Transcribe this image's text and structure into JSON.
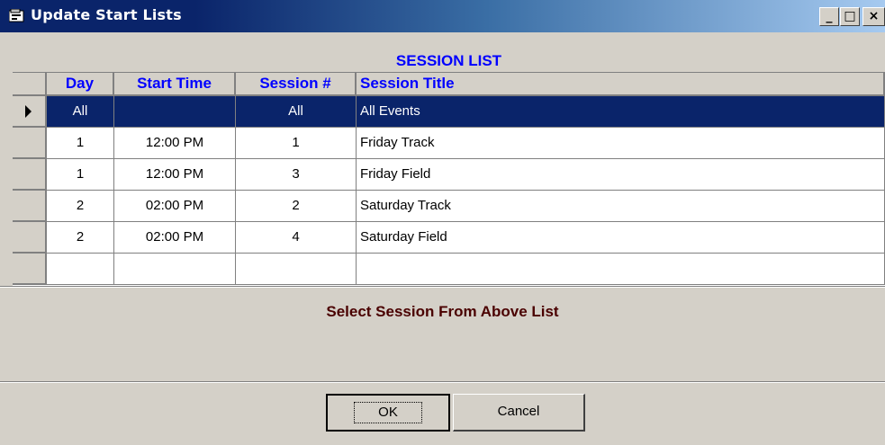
{
  "window": {
    "title": "Update Start Lists",
    "controls": {
      "minimize": "_",
      "maximize": "□",
      "close": "×"
    }
  },
  "grid": {
    "caption": "SESSION LIST",
    "columns": [
      "Day",
      "Start Time",
      "Session #",
      "Session Title"
    ],
    "rows": [
      {
        "day": "All",
        "start_time": "",
        "session": "All",
        "title": "All Events",
        "selected": true
      },
      {
        "day": "1",
        "start_time": "12:00 PM",
        "session": "1",
        "title": "Friday Track",
        "selected": false
      },
      {
        "day": "1",
        "start_time": "12:00 PM",
        "session": "3",
        "title": "Friday Field",
        "selected": false
      },
      {
        "day": "2",
        "start_time": "02:00 PM",
        "session": "2",
        "title": "Saturday Track",
        "selected": false
      },
      {
        "day": "2",
        "start_time": "02:00 PM",
        "session": "4",
        "title": "Saturday Field",
        "selected": false
      },
      {
        "day": "",
        "start_time": "",
        "session": "",
        "title": "",
        "selected": false
      }
    ]
  },
  "instruction": "Select Session From Above List",
  "buttons": {
    "ok": "OK",
    "cancel": "Cancel"
  },
  "colors": {
    "title_bar": "#0a246a",
    "selection": "#0a246a",
    "header_text": "#0000ff",
    "instruction_text": "#4a0000"
  }
}
